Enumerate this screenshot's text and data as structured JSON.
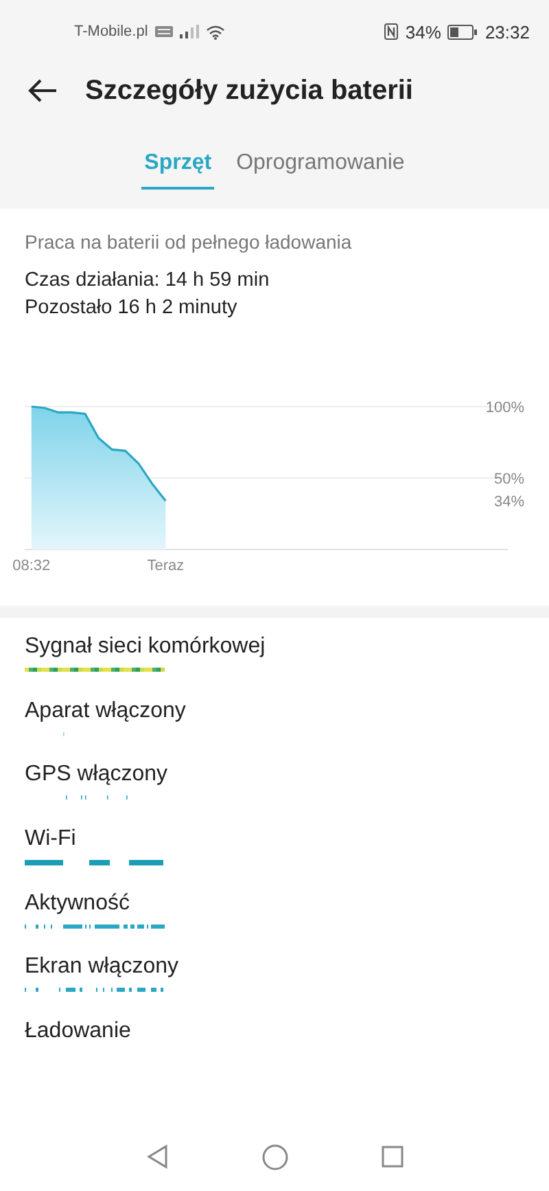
{
  "status_bar": {
    "carrier": "T-Mobile.pl",
    "battery": "34%",
    "time": "23:32"
  },
  "header": {
    "title": "Szczegóły zużycia baterii"
  },
  "tabs": [
    {
      "label": "Sprzęt",
      "selected": true
    },
    {
      "label": "Oprogramowanie",
      "selected": false
    }
  ],
  "summary": {
    "subtitle": "Praca na baterii od pełnego ładowania",
    "runtime": "Czas działania: 14 h 59 min",
    "remaining": "Pozostało 16 h 2 minuty"
  },
  "battery_chart": {
    "chart_data": {
      "type": "area",
      "ylim": [
        0,
        100
      ],
      "categories": [
        "08:32",
        null,
        null,
        null,
        null,
        null,
        null,
        null,
        null,
        null,
        "Teraz",
        null,
        null,
        null,
        null,
        null,
        null,
        null,
        null,
        null,
        null,
        null,
        null,
        null,
        null,
        null,
        null,
        null,
        null,
        null,
        null,
        null,
        null,
        null,
        null,
        null
      ],
      "yticks": [
        {
          "value": 100,
          "label": "100%"
        },
        {
          "value": 50,
          "label": "50%"
        },
        {
          "value": 34,
          "label": "34%"
        }
      ],
      "series": [
        {
          "color": "#2aa7c4",
          "values": [
            100,
            99,
            96,
            96,
            95,
            78,
            70,
            69,
            60,
            46,
            34,
            null,
            null,
            null,
            null,
            null,
            null,
            null,
            null,
            null,
            null,
            null,
            null,
            null,
            null,
            null,
            null,
            null,
            null,
            null,
            null,
            null,
            null,
            null,
            null,
            null
          ]
        }
      ]
    }
  },
  "usage": [
    {
      "label": "Sygnał sieci komórkowej"
    },
    {
      "label": "Aparat włączony"
    },
    {
      "label": "GPS włączony"
    },
    {
      "label": "Wi-Fi"
    },
    {
      "label": "Aktywność"
    },
    {
      "label": "Ekran włączony"
    },
    {
      "label": "Ładowanie"
    }
  ]
}
